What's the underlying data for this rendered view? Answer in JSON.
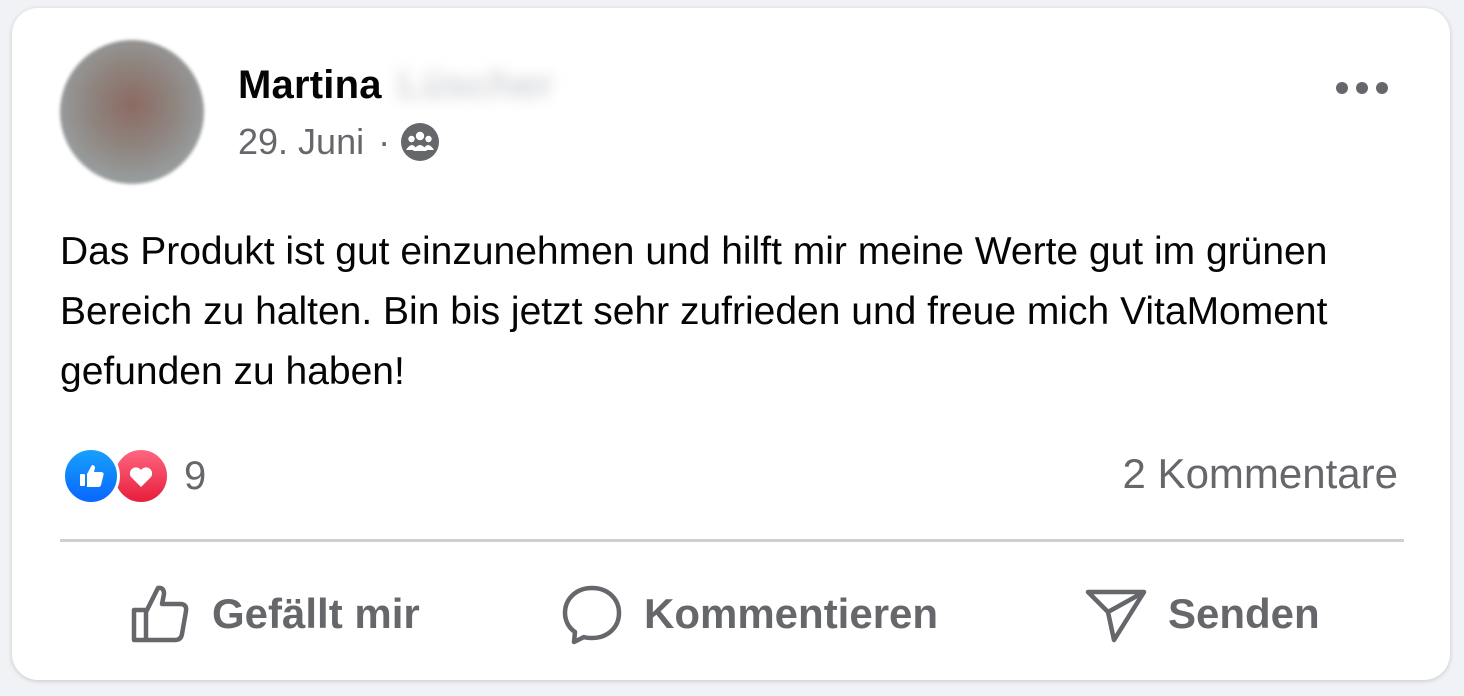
{
  "post": {
    "author_first_name": "Martina",
    "author_last_name_blurred": "Lüscher",
    "date": "29. Juni",
    "separator": "·",
    "audience_icon": "group-icon",
    "more_icon": "more-horizontal-icon",
    "text": "Das Produkt ist gut einzunehmen und hilft mir meine Werte gut im grünen Bereich zu halten. Bin bis jetzt sehr zufrieden und freue mich VitaMoment gefunden zu haben!"
  },
  "stats": {
    "reaction_icons": [
      "like-reaction-icon",
      "love-reaction-icon"
    ],
    "reaction_count": "9",
    "comments_label": "2 Kommentare"
  },
  "actions": {
    "like_label": "Gefällt mir",
    "comment_label": "Kommentieren",
    "send_label": "Senden"
  },
  "colors": {
    "like_blue": "#0866ff",
    "love_red": "#e61e3c",
    "secondary_text": "#65676b",
    "primary_text": "#050505"
  }
}
